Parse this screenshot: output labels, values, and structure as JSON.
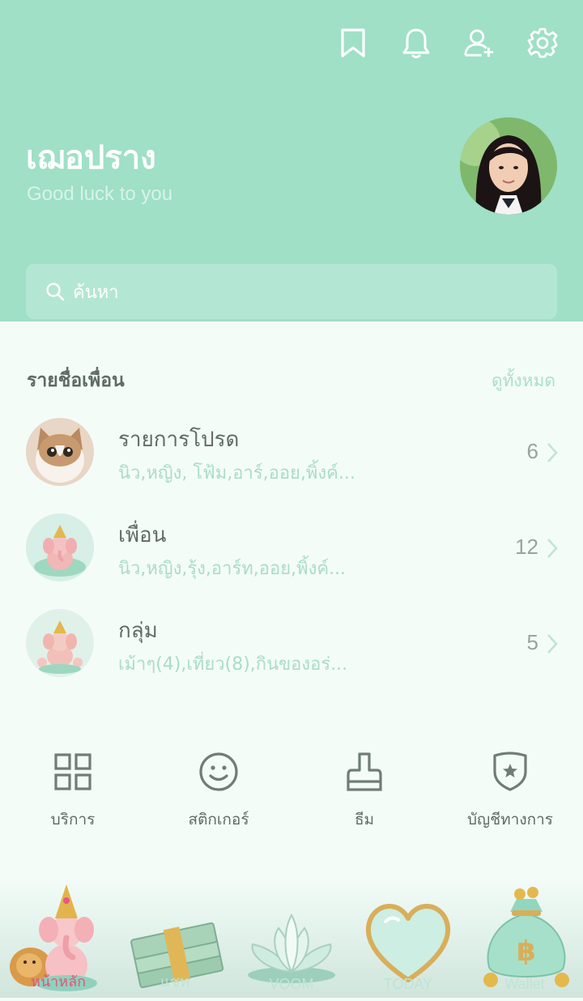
{
  "header": {
    "icons": [
      "bookmark-icon",
      "bell-icon",
      "add-friend-icon",
      "gear-icon"
    ],
    "profile_name": "เฌอปราง",
    "status_message": "Good luck to you",
    "search_placeholder": "ค้นหา"
  },
  "friends_section": {
    "title": "รายชื่อเพื่อน",
    "see_all": "ดูทั้งหมด",
    "rows": [
      {
        "title": "รายการโปรด",
        "subtitle": "นิว,หญิง, โฟ้ม,อาร์,ออย,พิ้งค์...",
        "count": "6"
      },
      {
        "title": "เพื่อน",
        "subtitle": "นิว,หญิง,รุ้ง,อาร์ท,ออย,พิ้งค์...",
        "count": "12"
      },
      {
        "title": "กลุ่ม",
        "subtitle": "เม้าๆ(4),เที่ยว(8),กินของอร่...",
        "count": "5"
      }
    ]
  },
  "services": [
    {
      "label": "บริการ",
      "icon": "grid-icon"
    },
    {
      "label": "สติกเกอร์",
      "icon": "smiley-icon"
    },
    {
      "label": "ธีม",
      "icon": "brush-icon"
    },
    {
      "label": "บัญชีทางการ",
      "icon": "shield-star-icon"
    }
  ],
  "tabbar": {
    "tabs": [
      {
        "label": "หน้าหลัก",
        "icon": "ganesha-lion-icon",
        "active": true
      },
      {
        "label": "แชท",
        "icon": "money-stack-icon",
        "active": false
      },
      {
        "label": "VOOM",
        "icon": "lotus-icon",
        "active": false
      },
      {
        "label": "TODAY",
        "icon": "heart-icon",
        "active": false
      },
      {
        "label": "Wallet",
        "icon": "money-bag-icon",
        "active": false
      }
    ]
  },
  "colors": {
    "header_bg": "#9fe0c6",
    "accent_mint": "#a9ddc8",
    "text_dark": "#5f6b66",
    "active_tab": "#e0557a"
  }
}
